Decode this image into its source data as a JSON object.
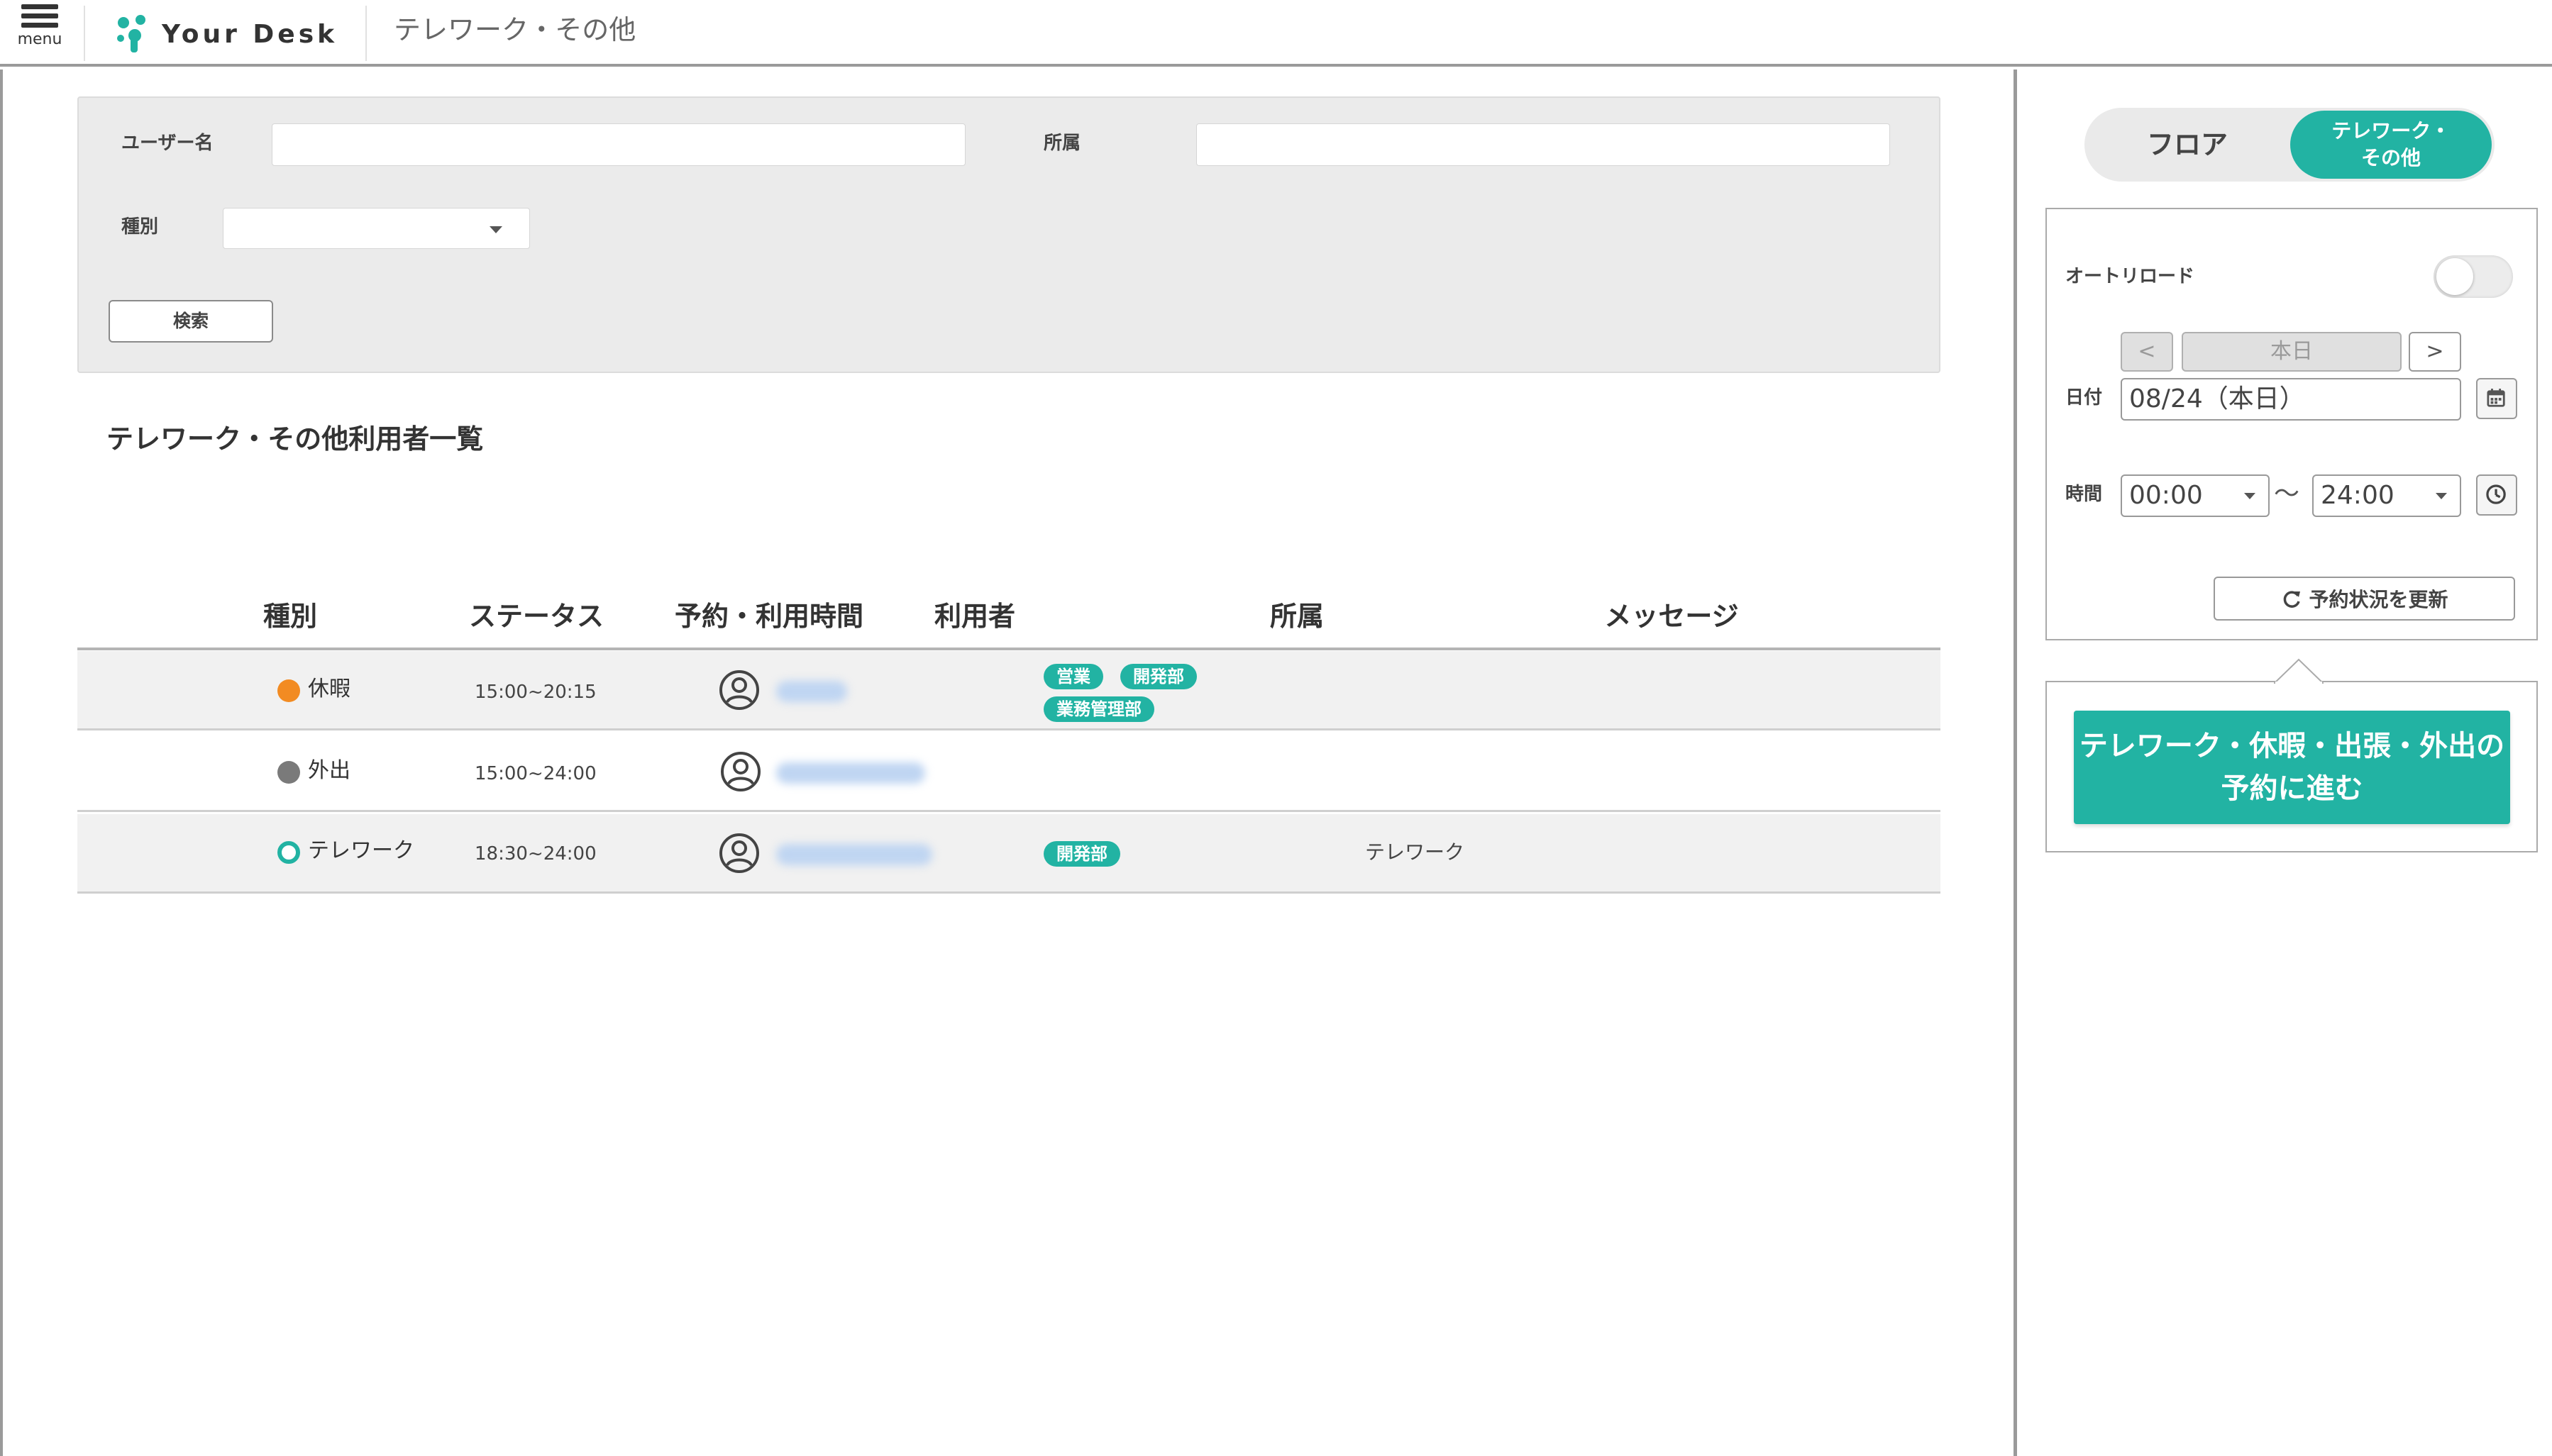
{
  "header": {
    "menu_label": "menu",
    "logo_text": "Your Desk",
    "page_title": "テレワーク・その他"
  },
  "search": {
    "username_label": "ユーザー名",
    "username_value": "",
    "affiliation_label": "所属",
    "affiliation_value": "",
    "type_label": "種別",
    "type_value": "",
    "search_button": "検索"
  },
  "list": {
    "title": "テレワーク・その他利用者一覧",
    "columns": [
      "種別",
      "ステータス",
      "予約・利用時間",
      "利用者",
      "所属",
      "メッセージ"
    ],
    "rows": [
      {
        "type": "休暇",
        "type_color": "#f28b22",
        "time": "15:00~20:15",
        "tags": [
          "営業",
          "開発部",
          "業務管理部"
        ],
        "message": ""
      },
      {
        "type": "外出",
        "type_color": "#7a7a7a",
        "time": "15:00~24:00",
        "tags": [],
        "message": ""
      },
      {
        "type": "テレワーク",
        "type_color": "#22b3a3",
        "time": "18:30~24:00",
        "tags": [
          "開発部"
        ],
        "message": "テレワーク"
      }
    ]
  },
  "sidebar": {
    "tab_floor": "フロア",
    "tab_telework_line1": "テレワーク・",
    "tab_telework_line2": "その他",
    "auto_reload_label": "オートリロード",
    "prev_label": "<",
    "today_label": "本日",
    "next_label": ">",
    "date_label": "日付",
    "date_value": "08/24（本日）",
    "time_label": "時間",
    "time_from": "00:00",
    "time_tilde": "〜",
    "time_to": "24:00",
    "refresh_label": "予約状況を更新",
    "cta_line1": "テレワーク・休暇・出張・外出の",
    "cta_line2": "予約に進む"
  },
  "colors": {
    "accent": "#22b3a3",
    "vacation": "#f28b22",
    "outing": "#7a7a7a"
  }
}
